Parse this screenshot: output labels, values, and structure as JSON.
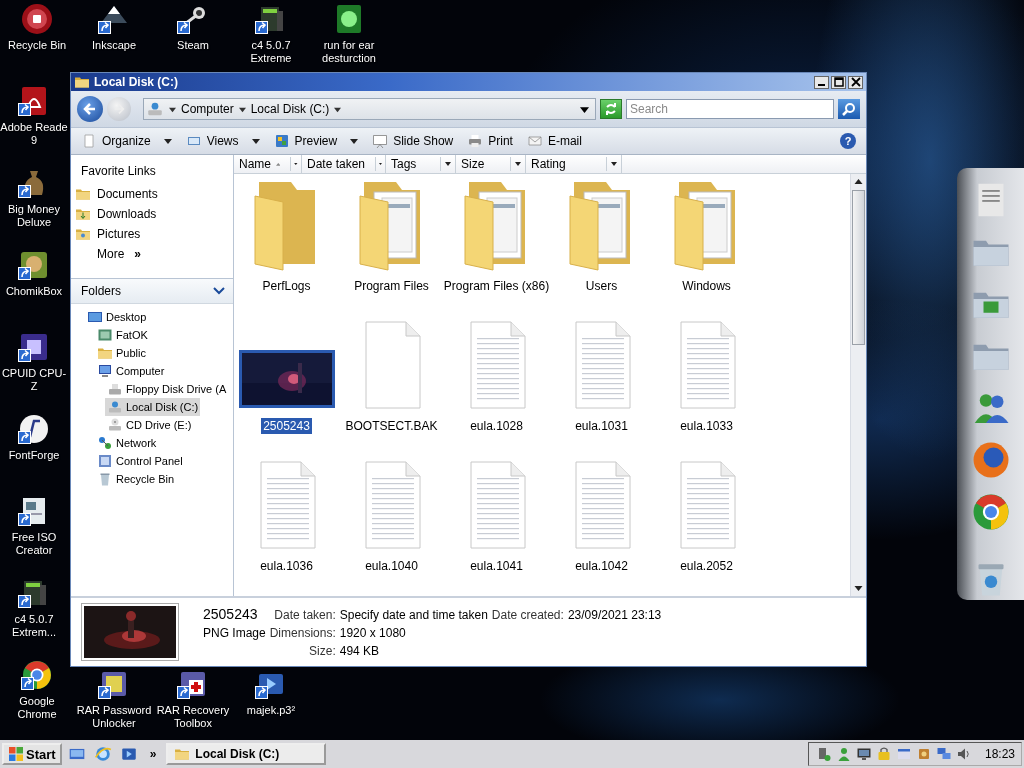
{
  "desktop": {
    "top_row": [
      {
        "label": "Recycle Bin",
        "kind": "recycle",
        "shortcut": false
      },
      {
        "label": "Inkscape",
        "kind": "inkscape",
        "shortcut": true
      },
      {
        "label": "Steam",
        "kind": "steam",
        "shortcut": true
      },
      {
        "label": "c4 5.0.7 Extreme",
        "kind": "c4",
        "shortcut": true
      },
      {
        "label": "run for ear desturction",
        "kind": "game",
        "shortcut": false
      }
    ],
    "left_column": [
      {
        "label": "Adobe Reade 9",
        "kind": "pdf",
        "shortcut": true
      },
      {
        "label": "Big Money Deluxe",
        "kind": "money",
        "shortcut": true
      },
      {
        "label": "ChomikBox",
        "kind": "chomik",
        "shortcut": true
      },
      {
        "label": "CPUID CPU-Z",
        "kind": "cpuz",
        "shortcut": true
      },
      {
        "label": "FontForge",
        "kind": "fontforge",
        "shortcut": true
      },
      {
        "label": "Free ISO Creator",
        "kind": "iso",
        "shortcut": true
      },
      {
        "label": "c4 5.0.7 Extrem...",
        "kind": "c4",
        "shortcut": true
      },
      {
        "label": "Google Chrome",
        "kind": "chrome",
        "shortcut": true
      }
    ],
    "bottom_row": [
      {
        "label": "RAR Password Unlocker",
        "kind": "rar",
        "shortcut": true
      },
      {
        "label": "RAR Recovery Toolbox",
        "kind": "rar_recovery",
        "shortcut": true
      },
      {
        "label": "majek.p3²",
        "kind": "media",
        "shortcut": true
      }
    ]
  },
  "window": {
    "title": "Local Disk (C:)",
    "address": {
      "crumbs": [
        "Computer",
        "Local Disk (C:)"
      ]
    },
    "search": {
      "placeholder": "Search"
    },
    "toolbar": [
      {
        "label": "Organize",
        "kind": "organize",
        "dropdown": true
      },
      {
        "label": "Views",
        "kind": "views",
        "dropdown": true
      },
      {
        "label": "Preview",
        "kind": "preview",
        "dropdown": true
      },
      {
        "label": "Slide Show",
        "kind": "slideshow",
        "dropdown": false
      },
      {
        "label": "Print",
        "kind": "print",
        "dropdown": false
      },
      {
        "label": "E-mail",
        "kind": "email",
        "dropdown": false
      }
    ],
    "help": "?",
    "favorite_links": {
      "title": "Favorite Links",
      "items": [
        {
          "label": "Documents",
          "kind": "documents"
        },
        {
          "label": "Downloads",
          "kind": "downloads"
        },
        {
          "label": "Pictures",
          "kind": "pictures"
        }
      ],
      "more": {
        "label": "More",
        "chevron": "»"
      }
    },
    "folders": {
      "title": "Folders",
      "expanded": true,
      "tree": [
        {
          "label": "Desktop",
          "kind": "desktop",
          "selected": false,
          "children": [
            {
              "label": "FatOK",
              "kind": "fatok",
              "selected": false
            },
            {
              "label": "Public",
              "kind": "folder_small",
              "selected": false
            },
            {
              "label": "Computer",
              "kind": "computer",
              "selected": false,
              "children": [
                {
                  "label": "Floppy Disk Drive (A",
                  "kind": "floppy",
                  "selected": false
                },
                {
                  "label": "Local Disk (C:)",
                  "kind": "disk",
                  "selected": true
                },
                {
                  "label": "CD Drive (E:)",
                  "kind": "cd",
                  "selected": false
                }
              ]
            },
            {
              "label": "Network",
              "kind": "network",
              "selected": false
            },
            {
              "label": "Control Panel",
              "kind": "control",
              "selected": false
            },
            {
              "label": "Recycle Bin",
              "kind": "recycle_small",
              "selected": false
            }
          ]
        }
      ]
    },
    "columns": [
      {
        "label": "Name",
        "sorted": true
      },
      {
        "label": "Date taken",
        "sorted": false
      },
      {
        "label": "Tags",
        "sorted": false
      },
      {
        "label": "Size",
        "sorted": false
      },
      {
        "label": "Rating",
        "sorted": false
      }
    ],
    "files": [
      {
        "name": "PerfLogs",
        "kind": "folder",
        "selected": false
      },
      {
        "name": "Program Files",
        "kind": "folder_docs",
        "selected": false
      },
      {
        "name": "Program Files (x86)",
        "kind": "folder_docs",
        "selected": false
      },
      {
        "name": "Users",
        "kind": "folder_docs",
        "selected": false
      },
      {
        "name": "Windows",
        "kind": "folder_docs",
        "selected": false
      },
      {
        "name": "2505243",
        "selected": true
      },
      {
        "name": "BOOTSECT.BAK",
        "kind": "blank",
        "selected": false
      },
      {
        "name": "eula.1028",
        "kind": "text",
        "selected": false
      },
      {
        "name": "eula.1031",
        "kind": "text",
        "selected": false
      },
      {
        "name": "eula.1033",
        "kind": "text",
        "selected": false
      },
      {
        "name": "eula.1036",
        "kind": "text",
        "selected": false
      },
      {
        "name": "eula.1040",
        "kind": "text",
        "selected": false
      },
      {
        "name": "eula.1041",
        "kind": "text",
        "selected": false
      },
      {
        "name": "eula.1042",
        "kind": "text",
        "selected": false
      },
      {
        "name": "eula.2052",
        "kind": "text",
        "selected": false
      }
    ],
    "details": {
      "rows": [
        {
          "lead": "2505243",
          "kind": "name",
          "props": [
            {
              "label": "Date taken:",
              "value": "Specify date and time taken"
            },
            {
              "label": "Date created:",
              "value": "23/09/2021 23:13"
            }
          ]
        },
        {
          "lead": "PNG Image",
          "kind": "type",
          "props": [
            {
              "label": "Dimensions:",
              "value": "1920 x 1080"
            }
          ]
        },
        {
          "kind": "none",
          "props": [
            {
              "label": "Size:",
              "value": "494 KB"
            }
          ]
        }
      ]
    }
  },
  "dock": {
    "items": [
      {
        "kind": "notepad"
      },
      {
        "kind": "folder"
      },
      {
        "kind": "folder_green"
      },
      {
        "kind": "folder"
      },
      {
        "kind": "people"
      },
      {
        "kind": "firefox"
      },
      {
        "kind": "chrome"
      },
      {
        "kind": "bin"
      }
    ]
  },
  "taskbar": {
    "start": "Start",
    "quick_launch": [
      {
        "kind": "show_desktop"
      },
      {
        "kind": "ie"
      },
      {
        "kind": "media"
      }
    ],
    "overflow": "»",
    "tasks": [
      {
        "title": "Local Disk (C:)"
      }
    ],
    "tray": [
      {
        "kind": "tray_device"
      },
      {
        "kind": "tray_user"
      },
      {
        "kind": "tray_monitor"
      },
      {
        "kind": "tray_lock"
      },
      {
        "kind": "tray_window"
      },
      {
        "kind": "tray_app"
      },
      {
        "kind": "tray_network"
      },
      {
        "kind": "tray_volume"
      }
    ],
    "clock": "18:23"
  }
}
